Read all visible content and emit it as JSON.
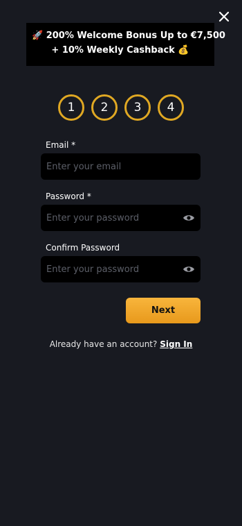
{
  "banner": {
    "line1_emoji": "🚀",
    "line1_text": "200% Welcome Bonus Up to €7,500",
    "line2_text": "+ 10% Weekly Cashback",
    "line2_emoji": "💰"
  },
  "steps": [
    "1",
    "2",
    "3",
    "4"
  ],
  "form": {
    "email_label": "Email *",
    "email_placeholder": "Enter your email",
    "password_label": "Password *",
    "password_placeholder": "Enter your password",
    "confirm_label": "Confirm Password",
    "confirm_placeholder": "Enter your password",
    "next_label": "Next"
  },
  "footer": {
    "prompt": "Already have an account?",
    "signin_label": "Sign In"
  },
  "icons": {
    "close": "close-icon",
    "eye": "eye-icon"
  },
  "colors": {
    "background": "#181a21",
    "accent": "#e0a823",
    "button": "#f5aa2e",
    "field": "#000000"
  }
}
